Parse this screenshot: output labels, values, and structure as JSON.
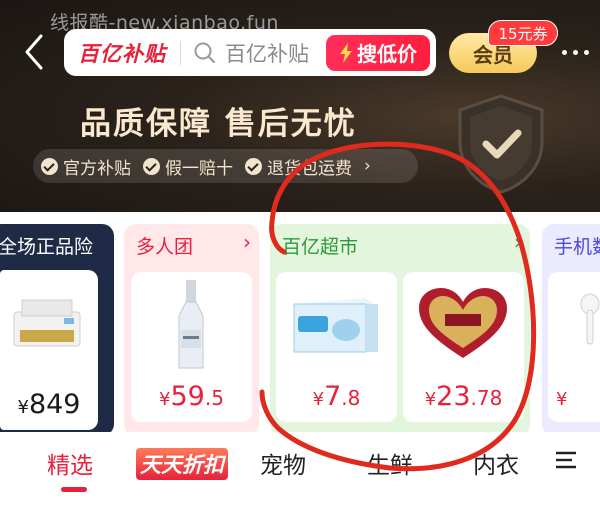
{
  "watermark": "线报酷-new.xianbao.fun",
  "header": {
    "brand": "百亿补贴",
    "search_placeholder": "百亿补贴",
    "search_button": "搜低价",
    "member_label": "会员",
    "coupon_badge": "15元券",
    "slogan": "品质保障 售后无忧",
    "benefits": [
      "官方补贴",
      "假一赔十",
      "退货包运费"
    ]
  },
  "cards": [
    {
      "title": "全场正品险",
      "price_yen": "¥",
      "price_int": "849",
      "price_dec": "",
      "product_icon": "printer-icon"
    },
    {
      "title": "多人团",
      "price_yen": "¥",
      "price_int": "59",
      "price_dec": ".5",
      "product_icon": "bottle-icon"
    },
    {
      "title": "百亿超市",
      "items": [
        {
          "price_yen": "¥",
          "price_int": "7",
          "price_dec": ".8",
          "product_icon": "saline-box-icon"
        },
        {
          "price_yen": "¥",
          "price_int": "23",
          "price_dec": ".78",
          "product_icon": "heart-candy-icon"
        }
      ]
    },
    {
      "title": "手机数",
      "product_icon": "earphones-icon"
    }
  ],
  "tabs": {
    "items": [
      "精选",
      "天天折扣",
      "宠物",
      "生鲜",
      "内衣"
    ],
    "active": "精选"
  },
  "colors": {
    "accent_red": "#e8213b",
    "supermarket_green": "#2a9a3a",
    "header_dark": "#1b1613",
    "annotation_red": "#e02a1e"
  }
}
